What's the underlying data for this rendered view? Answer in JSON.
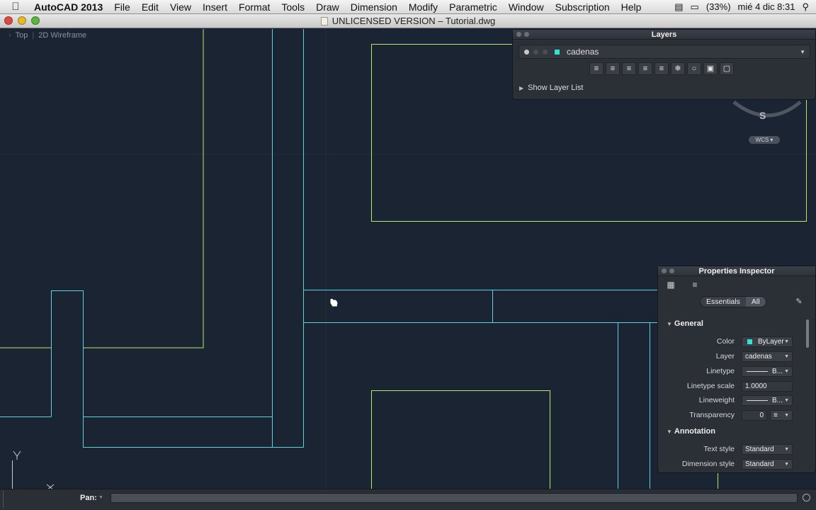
{
  "menubar": {
    "app_name": "AutoCAD 2013",
    "items": [
      "File",
      "Edit",
      "View",
      "Insert",
      "Format",
      "Tools",
      "Draw",
      "Dimension",
      "Modify",
      "Parametric",
      "Window",
      "Subscription",
      "Help"
    ],
    "battery": "(33%)",
    "date_time": "mié 4 dic  8:31"
  },
  "window": {
    "title": "UNLICENSED VERSION – Tutorial.dwg"
  },
  "viewport": {
    "view": "Top",
    "visual_style": "2D Wireframe"
  },
  "layers_panel": {
    "title": "Layers",
    "current_layer": "cadenas",
    "show_layer_list": "Show Layer List"
  },
  "viewcube": {
    "direction": "S",
    "ucs": "WCS"
  },
  "properties_inspector": {
    "title": "Properties Inspector",
    "seg_essentials": "Essentials",
    "seg_all": "All",
    "section_general": "General",
    "section_annotation": "Annotation",
    "rows": {
      "color_label": "Color",
      "color_value": "ByLayer",
      "layer_label": "Layer",
      "layer_value": "cadenas",
      "linetype_label": "Linetype",
      "linetype_value": "B...",
      "linetype_scale_label": "Linetype scale",
      "linetype_scale_value": "1.0000",
      "lineweight_label": "Lineweight",
      "lineweight_value": "B...",
      "transparency_label": "Transparency",
      "transparency_value": "0",
      "text_style_label": "Text style",
      "text_style_value": "Standard",
      "dimension_style_label": "Dimension style",
      "dimension_style_value": "Standard"
    }
  },
  "command_line": {
    "prompt": "Pan:"
  },
  "colors": {
    "canvas": "#1b2432",
    "cyan_lines": "#57d6e0",
    "green_lines": "#b6e86a",
    "layer_swatch": "#2fe3d5"
  }
}
